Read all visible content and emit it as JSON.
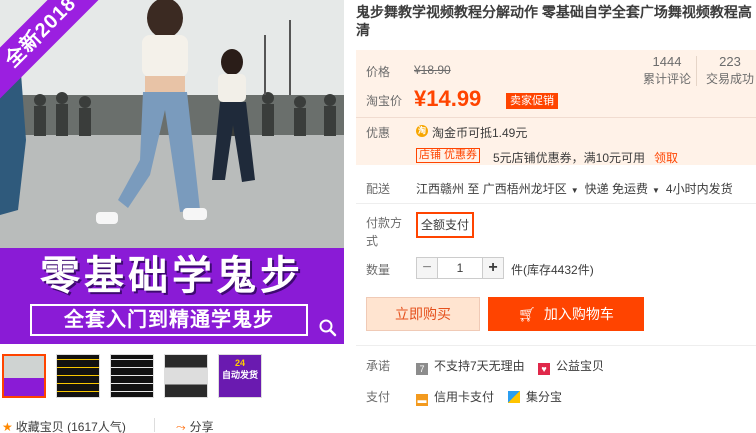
{
  "product": {
    "title": "鬼步舞教学视频教程分解动作 零基础自学全套广场舞视频教程高清"
  },
  "image": {
    "ribbon": "全新2018",
    "banner_title": "零基础学鬼步",
    "banner_sub": "全套入门到精通学鬼步"
  },
  "thumbnails": [
    {
      "label": "thumb-1"
    },
    {
      "label": "thumb-2"
    },
    {
      "label": "thumb-3"
    },
    {
      "label": "thumb-4"
    },
    {
      "label": "thumb-5",
      "text": "自动发货",
      "top": "24"
    }
  ],
  "collect": {
    "label": "收藏宝贝",
    "count": "(1617人气)"
  },
  "share": {
    "label": "分享"
  },
  "price": {
    "orig_label": "价格",
    "orig_value": "¥18.90",
    "cur_label": "淘宝价",
    "cur_value": "¥14.99",
    "promo": "卖家促销"
  },
  "stats": [
    {
      "num": "1444",
      "label": "累计评论"
    },
    {
      "num": "223",
      "label": "交易成功"
    }
  ],
  "offers": {
    "label": "优惠",
    "coin": "淘金币可抵1.49元",
    "shop_tag": "店铺 优惠券",
    "coupon": "5元店铺优惠券，满10元可用",
    "receive": "领取"
  },
  "delivery": {
    "label": "配送",
    "from": "江西赣州",
    "to_word": "至",
    "to": "广西梧州龙圩区",
    "method": "快递 免运费",
    "time": "4小时内发货"
  },
  "payment_option": {
    "label": "付款方式",
    "value": "全额支付"
  },
  "quantity": {
    "label": "数量",
    "value": "1",
    "minus": "−",
    "plus": "+",
    "stock": "件(库存4432件)"
  },
  "buttons": {
    "buy": "立即购买",
    "cart": "加入购物车"
  },
  "promise": {
    "label": "承诺",
    "item1": "不支持7天无理由",
    "item2": "公益宝贝"
  },
  "pay": {
    "label": "支付",
    "item1": "信用卡支付",
    "item2": "集分宝"
  },
  "colors": {
    "accent": "#ff4400",
    "banner": "#8a1bd6",
    "price_bg": "#fff2e8"
  }
}
